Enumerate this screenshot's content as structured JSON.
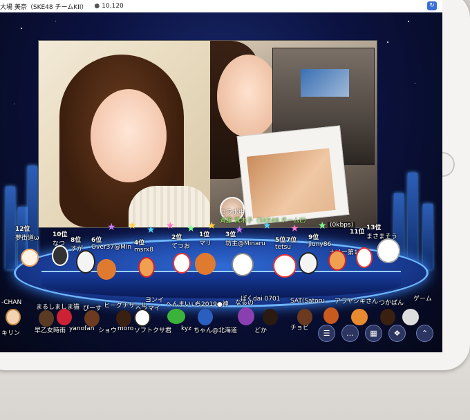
{
  "header": {
    "title": "大場 美奈（SKE48 チームKII）",
    "viewer_icon": "person-icon",
    "viewer_count": "10,120",
    "rotate_icon": "rotate-icon"
  },
  "broadcast": {
    "collab_status": "コラボ中",
    "collab_name": "斉藤 真木子（SKE48 チームE）",
    "bitrate": "(0kbps)"
  },
  "ranking": [
    {
      "pos": "12位",
      "name": "夢街道ω"
    },
    {
      "pos": "10位",
      "name": "なつ"
    },
    {
      "pos": "8位",
      "name": "すが"
    },
    {
      "pos": "6位",
      "name": "Over37@Min"
    },
    {
      "pos": "4位",
      "name": "msrx8"
    },
    {
      "pos": "2位",
      "name": "てつお"
    },
    {
      "pos": "1位",
      "name": "マリ"
    },
    {
      "pos": "3位",
      "name": "坊主@Minaru"
    },
    {
      "pos": "5位",
      "name": "tetsu"
    },
    {
      "pos": "7位",
      "name": ""
    },
    {
      "pos": "9位",
      "name": "jiuny86"
    },
    {
      "pos": "",
      "name": "ナリー第1"
    },
    {
      "pos": "11位",
      "name": ""
    },
    {
      "pos": "13位",
      "name": "まさまそう"
    }
  ],
  "crowd": [
    {
      "name": "-CHAN"
    },
    {
      "name": "まるしましま猫"
    },
    {
      "name": "ぴーす"
    },
    {
      "name": "ヒーグチサール"
    },
    {
      "name": "ヘンマイ"
    },
    {
      "name": "ヨンイ"
    },
    {
      "name": "へんまいぃ"
    },
    {
      "name": "ち2019●神"
    },
    {
      "name": "なるの"
    },
    {
      "name": "ぽくdai 0701"
    },
    {
      "name": "SAT(Satoru"
    },
    {
      "name": "アラヤシキさん"
    },
    {
      "name": "つかばん"
    },
    {
      "name": "ゲーム"
    },
    {
      "name": "キリン"
    },
    {
      "name": "早乙女時雨"
    },
    {
      "name": "yanofan"
    },
    {
      "name": "ショウ"
    },
    {
      "name": "moro"
    },
    {
      "name": "ソフトクサ君"
    },
    {
      "name": "kyz"
    },
    {
      "name": "ちゃん@北海道"
    },
    {
      "name": "どか"
    },
    {
      "name": "チョビ"
    }
  ],
  "toolbar": [
    {
      "icon": "list-icon"
    },
    {
      "icon": "comment-icon"
    },
    {
      "icon": "grid-icon"
    },
    {
      "icon": "gift-icon"
    },
    {
      "icon": "chevron-up-icon"
    }
  ],
  "colors": {
    "topbar_bg": "#ffffff",
    "collab_name": "#9ef36b",
    "stage_glow": "#3b8cff",
    "toolbar_bg": "#2c3560"
  }
}
